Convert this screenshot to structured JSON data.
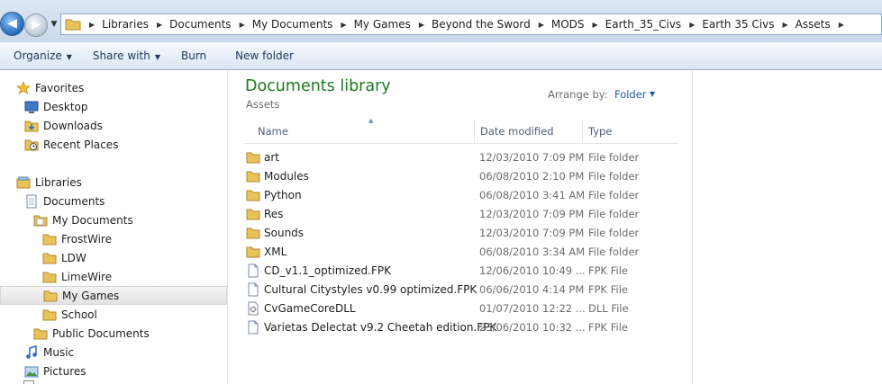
{
  "breadcrumb": {
    "items": [
      "Libraries",
      "Documents",
      "My Documents",
      "My Games",
      "Beyond the Sword",
      "MODS",
      "Earth_35_Civs",
      "Earth 35 Civs",
      "Assets"
    ]
  },
  "toolbar": {
    "organize": "Organize",
    "share_with": "Share with",
    "burn": "Burn",
    "new_folder": "New folder"
  },
  "nav": {
    "favorites": "Favorites",
    "desktop": "Desktop",
    "downloads": "Downloads",
    "recent_places": "Recent Places",
    "libraries": "Libraries",
    "documents": "Documents",
    "my_documents": "My Documents",
    "frostwire": "FrostWire",
    "ldw": "LDW",
    "limewire": "LimeWire",
    "my_games": "My Games",
    "school": "School",
    "public_documents": "Public Documents",
    "music": "Music",
    "pictures": "Pictures"
  },
  "content": {
    "title": "Documents library",
    "subtitle": "Assets",
    "arrange_label": "Arrange by:",
    "arrange_value": "Folder"
  },
  "columns": {
    "name": "Name",
    "date": "Date modified",
    "type": "Type"
  },
  "files": [
    {
      "name": "art",
      "date": "12/03/2010 7:09 PM",
      "type": "File folder"
    },
    {
      "name": "Modules",
      "date": "06/08/2010 2:10 PM",
      "type": "File folder"
    },
    {
      "name": "Python",
      "date": "06/08/2010 3:41 AM",
      "type": "File folder"
    },
    {
      "name": "Res",
      "date": "12/03/2010 7:09 PM",
      "type": "File folder"
    },
    {
      "name": "Sounds",
      "date": "12/03/2010 7:09 PM",
      "type": "File folder"
    },
    {
      "name": "XML",
      "date": "06/08/2010 3:34 AM",
      "type": "File folder"
    },
    {
      "name": "CD_v1.1_optimized.FPK",
      "date": "12/06/2010 10:49 ...",
      "type": "FPK File"
    },
    {
      "name": "Cultural Citystyles v0.99 optimized.FPK",
      "date": "06/06/2010 4:14 PM",
      "type": "FPK File"
    },
    {
      "name": "CvGameCoreDLL",
      "date": "01/07/2010 12:22 ...",
      "type": "DLL File"
    },
    {
      "name": "Varietas Delectat v9.2 Cheetah edition.FPK",
      "date": "23/06/2010 10:32 ...",
      "type": "FPK File"
    }
  ],
  "colors": {
    "library_title": "#1e7a1e",
    "link_blue": "#1e5aa8",
    "folder_yellow": "#e8c35a"
  }
}
